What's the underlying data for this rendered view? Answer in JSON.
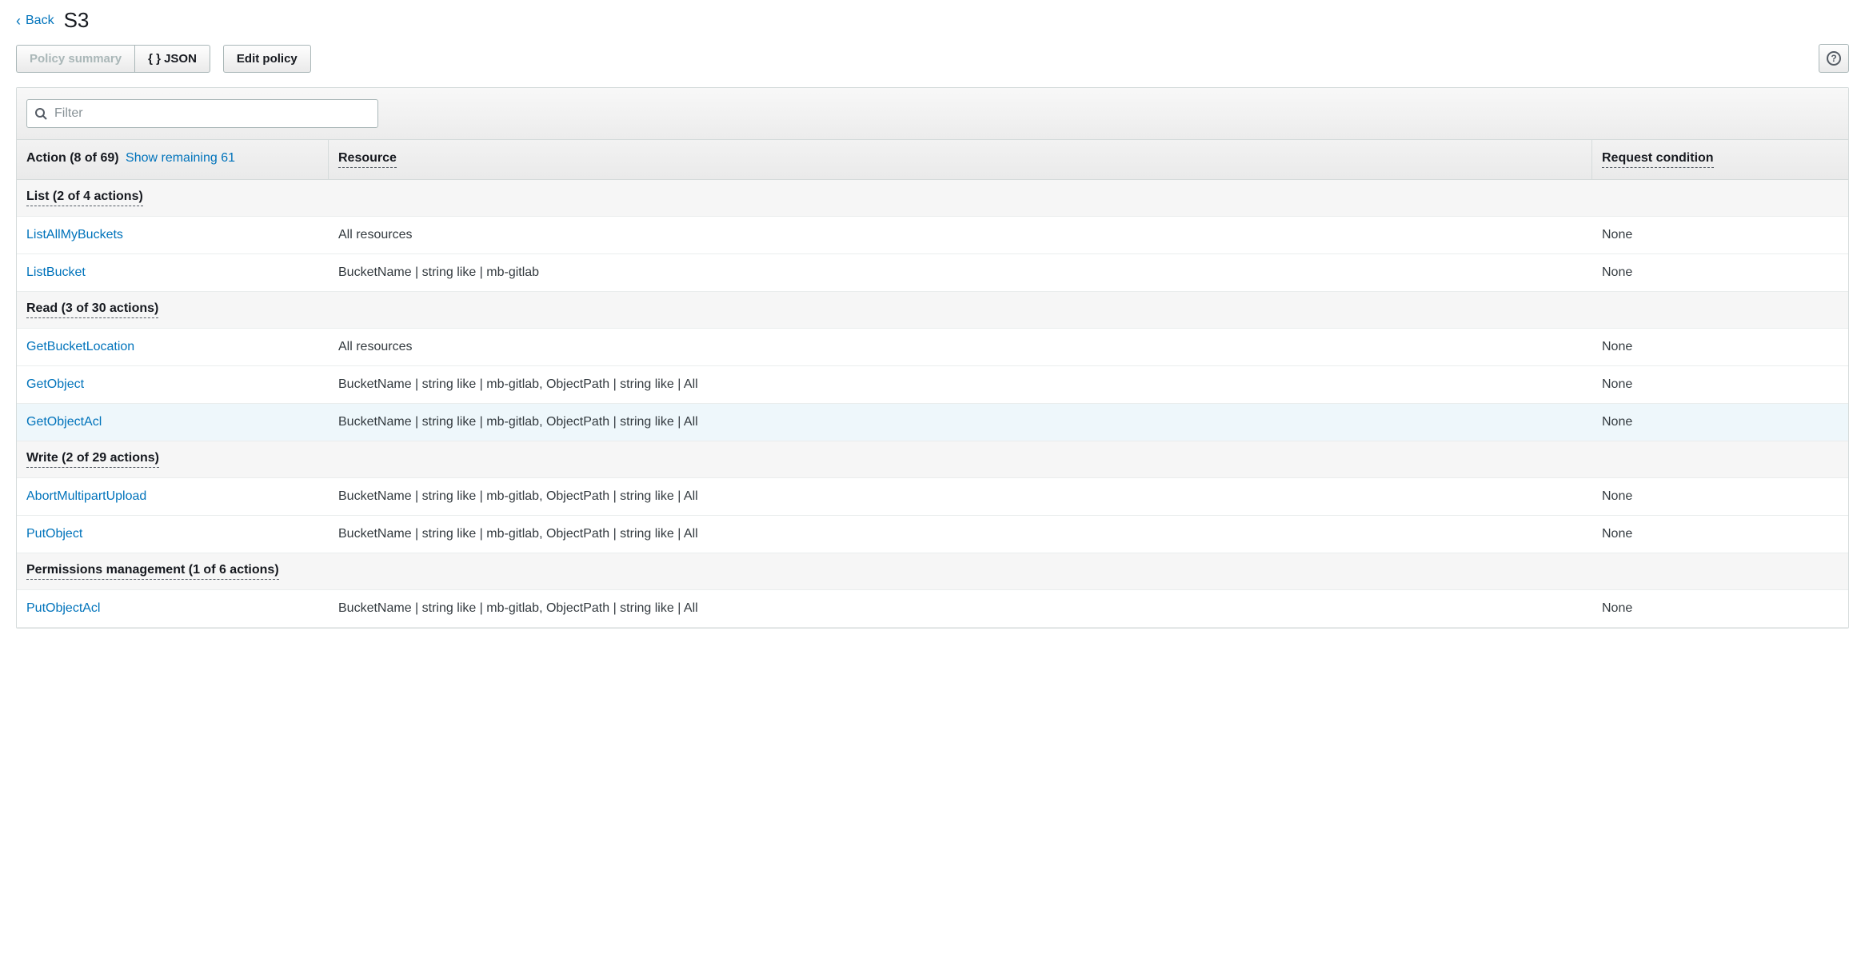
{
  "header": {
    "back_label": "Back",
    "title": "S3"
  },
  "toolbar": {
    "policy_summary_label": "Policy summary",
    "json_label": "{ } JSON",
    "edit_policy_label": "Edit policy"
  },
  "filter": {
    "placeholder": "Filter"
  },
  "table_headers": {
    "action_label": "Action (8 of 69)",
    "show_remaining_label": "Show remaining 61",
    "resource_label": "Resource",
    "condition_label": "Request condition"
  },
  "groups": [
    {
      "title": "List (2 of 4 actions)",
      "rows": [
        {
          "action": "ListAllMyBuckets",
          "resource": "All resources",
          "condition": "None",
          "highlighted": false
        },
        {
          "action": "ListBucket",
          "resource": "BucketName | string like | mb-gitlab",
          "condition": "None",
          "highlighted": false
        }
      ]
    },
    {
      "title": "Read (3 of 30 actions)",
      "rows": [
        {
          "action": "GetBucketLocation",
          "resource": "All resources",
          "condition": "None",
          "highlighted": false
        },
        {
          "action": "GetObject",
          "resource": "BucketName | string like | mb-gitlab, ObjectPath | string like | All",
          "condition": "None",
          "highlighted": false
        },
        {
          "action": "GetObjectAcl",
          "resource": "BucketName | string like | mb-gitlab, ObjectPath | string like | All",
          "condition": "None",
          "highlighted": true
        }
      ]
    },
    {
      "title": "Write (2 of 29 actions)",
      "rows": [
        {
          "action": "AbortMultipartUpload",
          "resource": "BucketName | string like | mb-gitlab, ObjectPath | string like | All",
          "condition": "None",
          "highlighted": false
        },
        {
          "action": "PutObject",
          "resource": "BucketName | string like | mb-gitlab, ObjectPath | string like | All",
          "condition": "None",
          "highlighted": false
        }
      ]
    },
    {
      "title": "Permissions management (1 of 6 actions)",
      "rows": [
        {
          "action": "PutObjectAcl",
          "resource": "BucketName | string like | mb-gitlab, ObjectPath | string like | All",
          "condition": "None",
          "highlighted": false
        }
      ]
    }
  ]
}
